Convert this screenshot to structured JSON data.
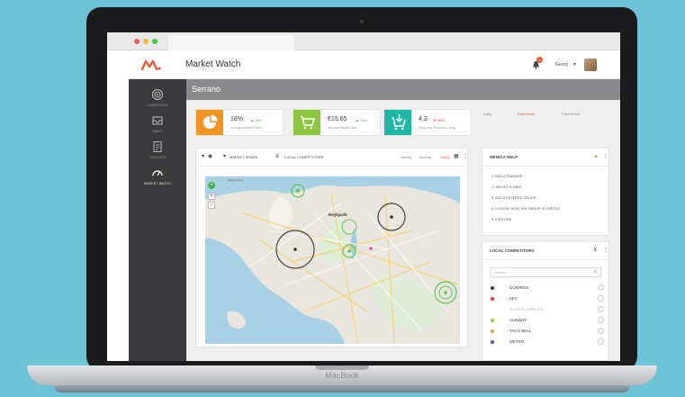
{
  "device": {
    "brand": "MacBook"
  },
  "app": {
    "title": "Market Watch",
    "user_name": "Georg",
    "notifications": "1"
  },
  "sidebar": {
    "items": [
      {
        "label": "CAMPAIGNS",
        "icon": "target-icon"
      },
      {
        "label": "INBOX",
        "icon": "inbox-icon"
      },
      {
        "label": "INVOICES",
        "icon": "invoice-icon"
      },
      {
        "label": "MARKET WATCH",
        "icon": "gauge-icon",
        "active": true
      }
    ]
  },
  "page": {
    "title": "Serrano"
  },
  "kpis": [
    {
      "value": "18%",
      "change": "▲ 13%",
      "direction": "up",
      "label": "Average Market Share",
      "color": "#f29422",
      "icon": "pie-chart-icon"
    },
    {
      "value": "€15.65",
      "change": "▲ 21%",
      "direction": "up",
      "label": "Average Basket Size",
      "color": "#8cc63f",
      "icon": "cart-icon"
    },
    {
      "value": "4.3",
      "change": "▼ 58%",
      "direction": "down",
      "label": "Shopping Frequency (avg)",
      "color": "#1fb8a6",
      "icon": "cart-download-icon"
    }
  ],
  "periods": [
    {
      "label": "Daily",
      "active": false
    },
    {
      "label": "Past Week",
      "active": true
    },
    {
      "label": "Past Month",
      "active": false
    }
  ],
  "map_panel": {
    "market_share_label": "MARKET SHARE",
    "local_competitors_label": "LOCAL COMPETITORS",
    "ranges": [
      {
        "label": "Weekly",
        "active": false
      },
      {
        "label": "Monthly",
        "active": false
      },
      {
        "label": "Yearly",
        "active": true
      }
    ],
    "city_label": "Reykjavik",
    "credit": "Seltjarnarnes"
  },
  "help": {
    "title": "MENIGA HELP",
    "items": [
      "1. ADD A TRACKER",
      "2. SELECT A VIEW",
      "3. ADD A FILTERED GROUP",
      "4. CHOOSE HOW THE GROUP IS SORTED",
      "5. EXPLORE"
    ]
  },
  "competitors": {
    "title": "LOCAL COMPETITORS",
    "search_placeholder": "Search",
    "items": [
      {
        "name": "DOMINOS",
        "color": "#333333",
        "dimmed": false
      },
      {
        "name": "KFC",
        "color": "#e0403a",
        "dimmed": false
      },
      {
        "name": "DUNKIN DONUTS",
        "color": "#ffffff",
        "dimmed": true
      },
      {
        "name": "SUBWAY",
        "color": "#8cc63f",
        "dimmed": false
      },
      {
        "name": "TACO BELL",
        "color": "#f29422",
        "dimmed": false
      },
      {
        "name": "METRO",
        "color": "#6a4fb3",
        "dimmed": false
      }
    ]
  }
}
